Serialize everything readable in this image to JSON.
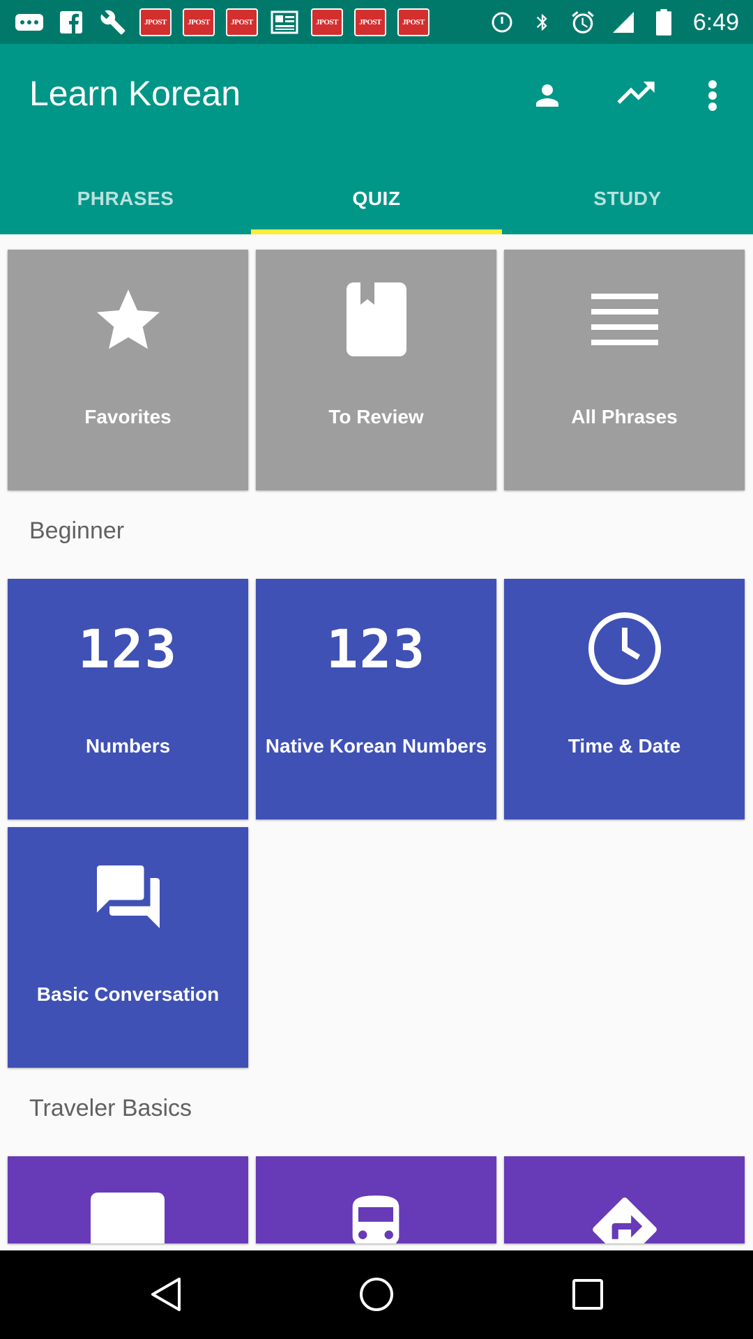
{
  "status_bar": {
    "time": "6:49",
    "left_icons": [
      "more-icon",
      "facebook-icon",
      "wrench-icon",
      "jpost-icon",
      "jpost-icon",
      "jpost-icon",
      "news-icon",
      "jpost-icon",
      "jpost-icon",
      "jpost-icon"
    ],
    "jpost_label": "JPOST",
    "right_icons": [
      "data-saver-icon",
      "bluetooth-icon",
      "alarm-icon",
      "signal-icon",
      "battery-icon"
    ]
  },
  "app_bar": {
    "title": "Learn Korean",
    "actions": [
      "person-icon",
      "trending-up-icon",
      "more-vert-icon"
    ],
    "tabs": [
      {
        "label": "PHRASES",
        "active": false
      },
      {
        "label": "QUIZ",
        "active": true
      },
      {
        "label": "STUDY",
        "active": false
      }
    ],
    "indicator_color": "#ffeb3b"
  },
  "top_tiles": [
    {
      "label": "Favorites",
      "icon": "star-icon"
    },
    {
      "label": "To Review",
      "icon": "bookmark-icon"
    },
    {
      "label": "All Phrases",
      "icon": "list-icon"
    }
  ],
  "sections": [
    {
      "title": "Beginner",
      "tiles": [
        {
          "label": "Numbers",
          "icon": "numbers-icon",
          "glyph": "123"
        },
        {
          "label": "Native Korean Numbers",
          "icon": "numbers-icon",
          "glyph": "123"
        },
        {
          "label": "Time & Date",
          "icon": "clock-icon"
        },
        {
          "label": "Basic Conversation",
          "icon": "forum-icon"
        }
      ]
    },
    {
      "title": "Traveler Basics",
      "tiles": [
        {
          "label": "",
          "icon": "tablet-icon"
        },
        {
          "label": "",
          "icon": "bus-icon"
        },
        {
          "label": "",
          "icon": "directions-icon"
        }
      ]
    }
  ],
  "colors": {
    "primary": "#009688",
    "primary_dark": "#00796b",
    "tile_grey": "#9e9e9e",
    "tile_blue": "#3f51b5",
    "tile_purple": "#673ab7"
  }
}
